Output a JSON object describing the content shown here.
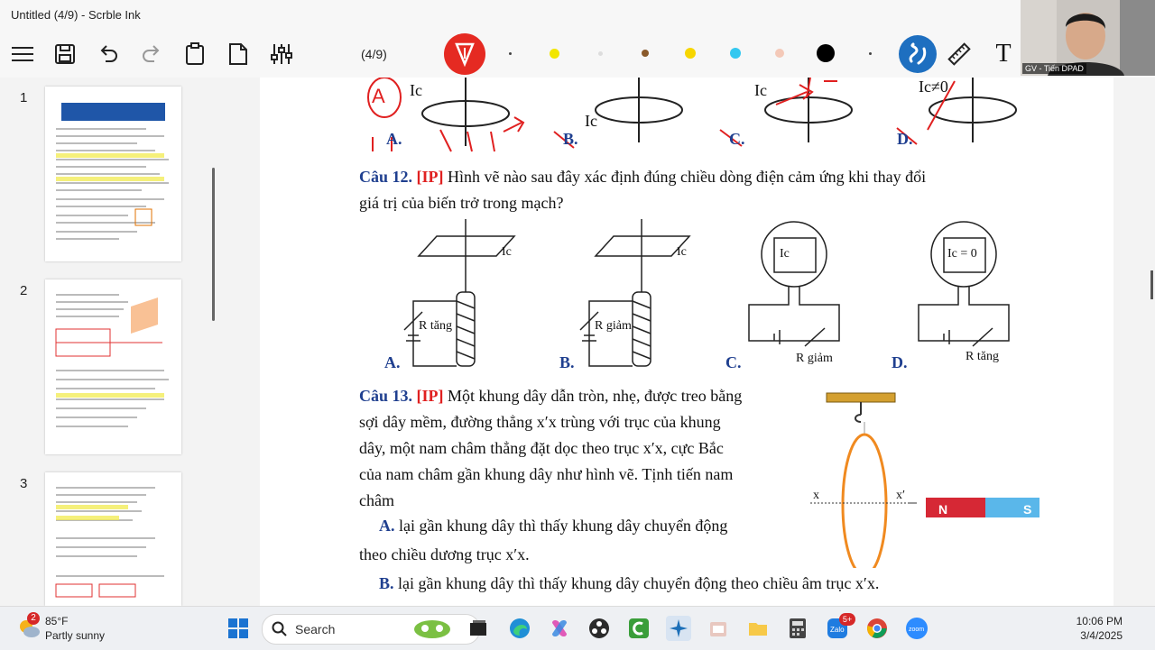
{
  "window": {
    "title": "Untitled (4/9) - Scrble Ink"
  },
  "toolbar": {
    "page_indicator": "(4/9)",
    "colors": [
      "#444444",
      "#f2e600",
      "#dddddd",
      "#8a5a2b",
      "#f7d600",
      "#34c8f0",
      "#f4c9b8",
      "#000000",
      "#444444"
    ],
    "text_tool": "T"
  },
  "camera": {
    "label": "GV - Tiến DPAD"
  },
  "sidebar": {
    "pages": [
      {
        "num": "1"
      },
      {
        "num": "2"
      },
      {
        "num": "3"
      }
    ]
  },
  "document": {
    "q11": {
      "handwritten_A": "A",
      "labels": [
        "Ic",
        "Ic",
        "Ic",
        "Ic≠0"
      ],
      "options": [
        "A.",
        "B.",
        "C.",
        "D."
      ]
    },
    "q12": {
      "num": "Câu 12.",
      "ip": "[IP]",
      "text1": "Hình vẽ nào sau đây xác định đúng chiều dòng điện cảm ứng khi thay đổi",
      "text2": "giá trị của biến trở trong mạch?",
      "options": [
        "A.",
        "B.",
        "C.",
        "D."
      ],
      "labels": {
        "ic": "Ic",
        "r_tang": "R tăng",
        "r_giam": "R giảm",
        "ic0": "Ic = 0"
      }
    },
    "q13": {
      "num": "Câu 13.",
      "ip": "[IP]",
      "lines": [
        "Một khung dây dẫn tròn, nhẹ, được treo bằng",
        "sợi dây mềm, đường thẳng x′x trùng với trục của khung",
        "dây, một nam châm thẳng đặt dọc theo trục x′x, cực Bắc",
        "của nam châm gần khung dây như hình vẽ. Tịnh tiến nam",
        "châm"
      ],
      "optA_label": "A.",
      "optA_text": "lại gần khung dây thì thấy khung dây chuyển động",
      "optA_text2": "theo chiều dương trục x′x.",
      "optB_label": "B.",
      "optB_text": "lại gần khung dây thì thấy khung dây chuyển động theo chiều âm trục x′x.",
      "fig": {
        "x": "x",
        "xp": "x′",
        "n": "N",
        "s": "S"
      }
    }
  },
  "taskbar": {
    "weather_temp": "85°F",
    "weather_desc": "Partly sunny",
    "weather_badge": "2",
    "search_placeholder": "Search",
    "zalo_badge": "5+",
    "time": "10:06 PM",
    "date": "3/4/2025"
  }
}
